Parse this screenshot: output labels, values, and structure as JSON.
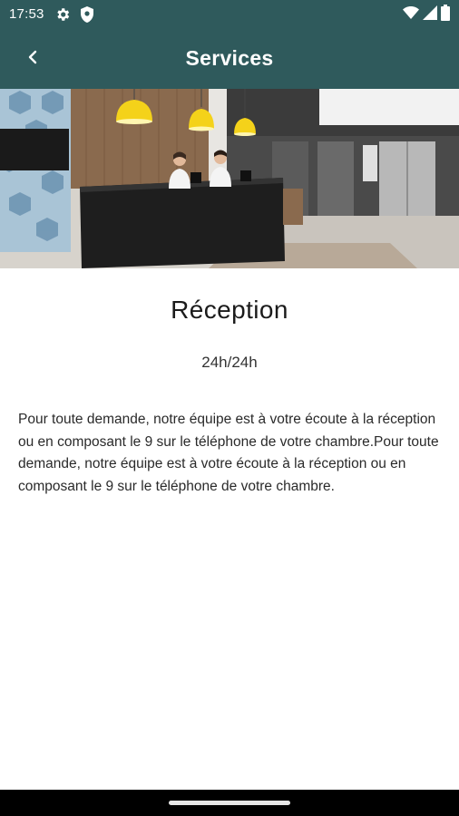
{
  "status_bar": {
    "time": "17:53",
    "icons": [
      "gear-icon",
      "shield-icon",
      "wifi-icon",
      "signal-icon",
      "battery-icon"
    ]
  },
  "app_bar": {
    "title": "Services",
    "back_icon": "chevron-left-icon",
    "background": "#2f5a5c"
  },
  "hero_image": {
    "description_icon": "reception-photo"
  },
  "service": {
    "title": "Réception",
    "hours": "24h/24h",
    "description": "Pour toute demande, notre équipe est à votre écoute à la réception ou en composant le 9 sur le téléphone de votre chambre.Pour toute demande, notre équipe est à votre écoute à la réception ou en composant le 9 sur le téléphone de votre chambre."
  },
  "colors": {
    "primary": "#2f5a5c",
    "lamp": "#f4d21a"
  }
}
